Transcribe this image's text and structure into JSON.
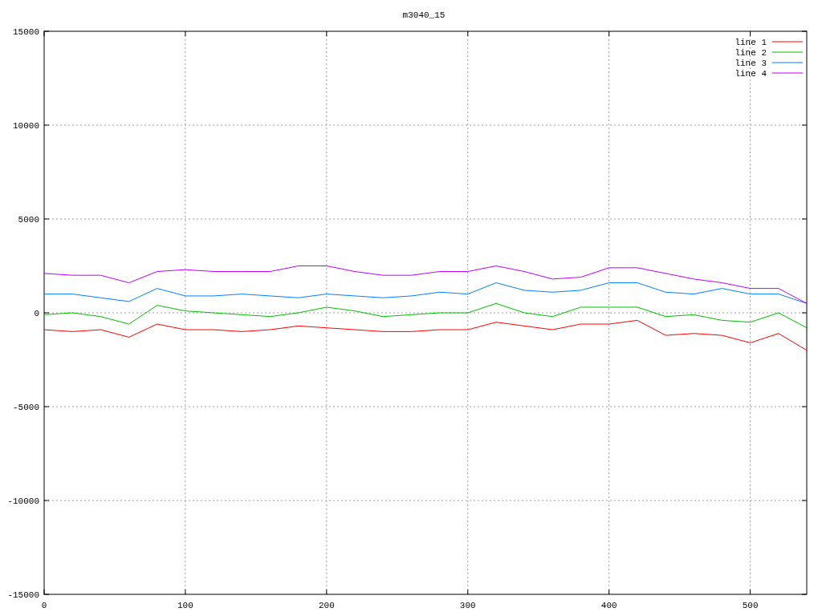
{
  "chart_data": {
    "type": "line",
    "title": "m3040_15",
    "x": [
      0,
      20,
      40,
      60,
      80,
      100,
      120,
      140,
      160,
      180,
      200,
      220,
      240,
      260,
      280,
      300,
      320,
      340,
      360,
      380,
      400,
      420,
      440,
      460,
      480,
      500,
      520,
      540
    ],
    "series": [
      {
        "name": "line 1",
        "color": "#ff0000",
        "values": [
          -900,
          -1000,
          -900,
          -1300,
          -600,
          -900,
          -900,
          -1000,
          -900,
          -700,
          -800,
          -900,
          -1000,
          -1000,
          -900,
          -900,
          -500,
          -700,
          -900,
          -600,
          -600,
          -400,
          -1200,
          -1100,
          -1200,
          -1600,
          -1100,
          -2000
        ]
      },
      {
        "name": "line 2",
        "color": "#00c000",
        "values": [
          -100,
          0,
          -200,
          -600,
          400,
          100,
          0,
          -100,
          -200,
          0,
          300,
          100,
          -200,
          -100,
          0,
          0,
          500,
          0,
          -200,
          300,
          300,
          300,
          -200,
          -100,
          -400,
          -500,
          0,
          -800
        ]
      },
      {
        "name": "line 3",
        "color": "#0080ff",
        "values": [
          1000,
          1000,
          800,
          600,
          1300,
          900,
          900,
          1000,
          900,
          800,
          1000,
          900,
          800,
          900,
          1100,
          1000,
          1600,
          1200,
          1100,
          1200,
          1600,
          1600,
          1100,
          1000,
          1300,
          1000,
          1000,
          500
        ]
      },
      {
        "name": "line 4",
        "color": "#c000ff",
        "values": [
          2100,
          2000,
          2000,
          1600,
          2200,
          2300,
          2200,
          2200,
          2200,
          2500,
          2500,
          2200,
          2000,
          2000,
          2200,
          2200,
          2500,
          2200,
          1800,
          1900,
          2400,
          2400,
          2100,
          1800,
          1600,
          1300,
          1300,
          500
        ]
      }
    ],
    "xlim": [
      0,
      540
    ],
    "ylim": [
      -15000,
      15000
    ],
    "xticks": [
      0,
      100,
      200,
      300,
      400,
      500
    ],
    "yticks": [
      -15000,
      -10000,
      -5000,
      0,
      5000,
      10000,
      15000
    ],
    "grid": true,
    "legend": true
  }
}
